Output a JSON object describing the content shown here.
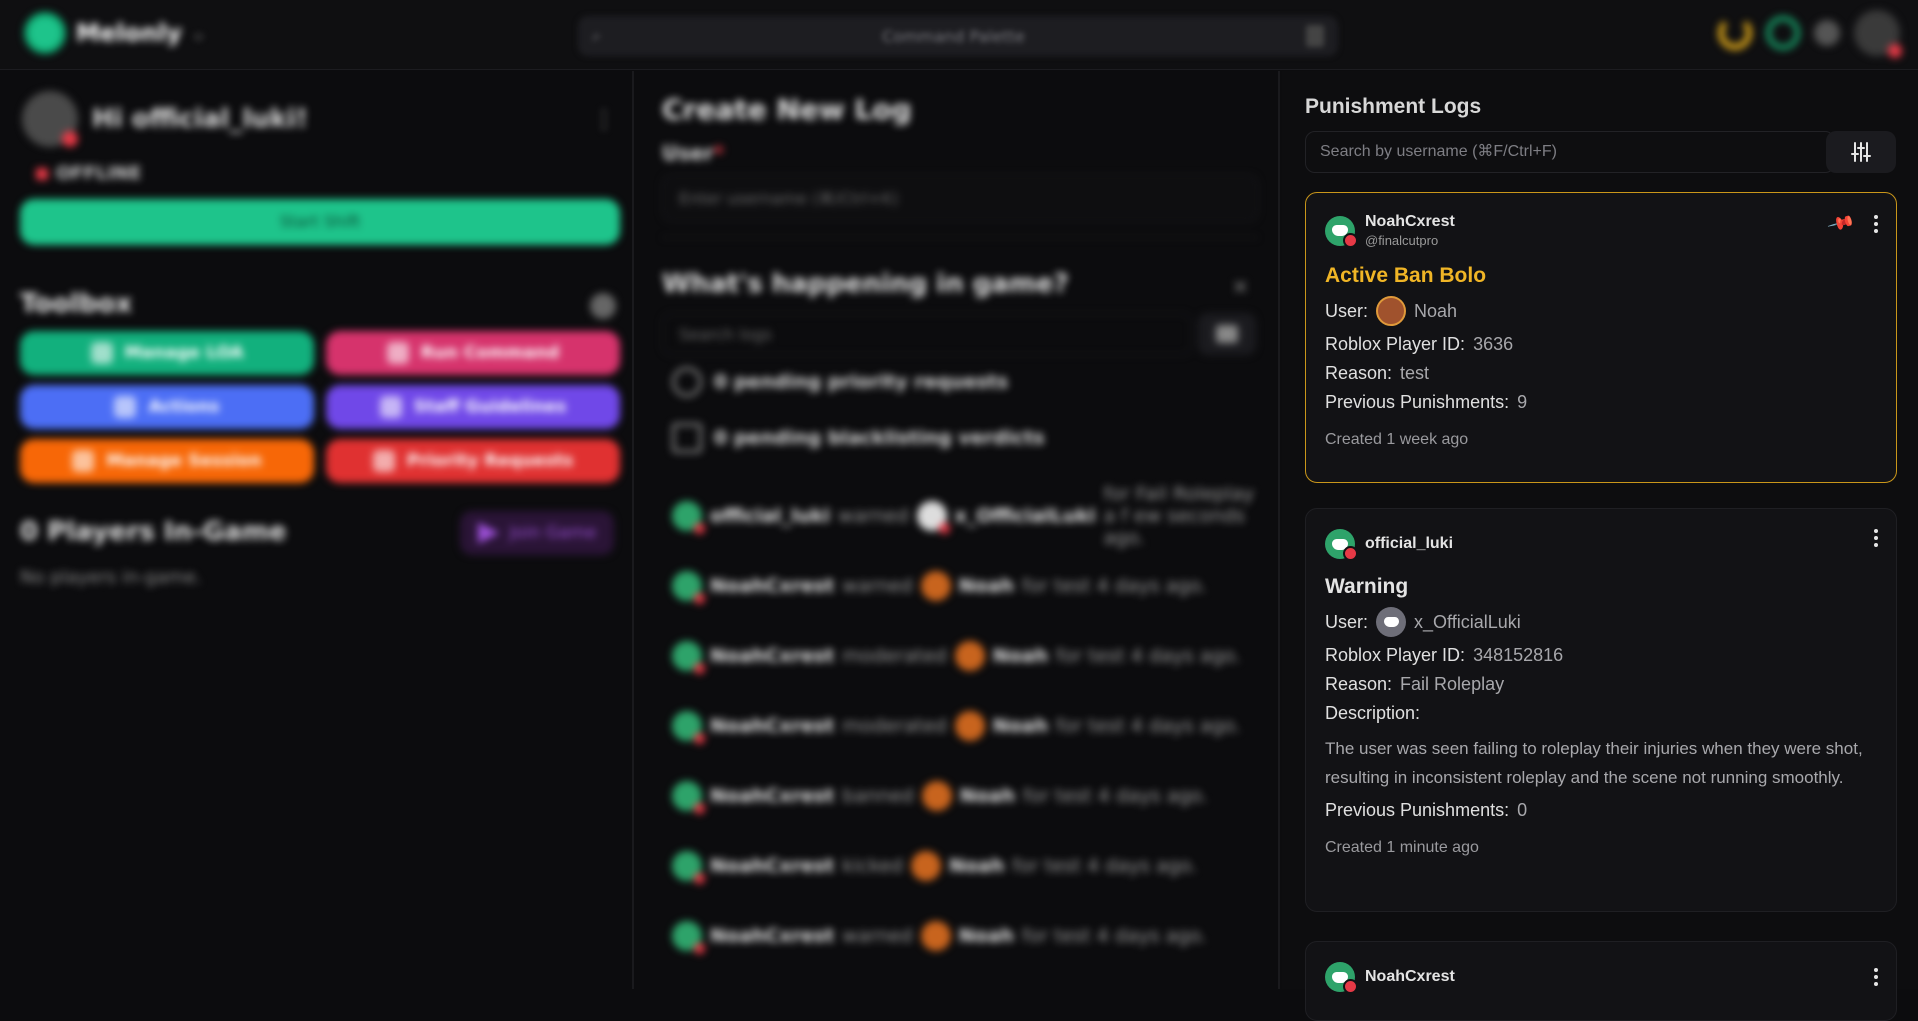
{
  "topbar": {
    "brand": "Melonly",
    "command_palette": "Command Palette"
  },
  "left": {
    "greeting": "Hi official_luki!",
    "status": "OFFLINE",
    "start_shift": "Start Shift",
    "toolbox_title": "Toolbox",
    "tools": [
      {
        "label": "Manage LOA",
        "color": "#12b07d"
      },
      {
        "label": "Run Command",
        "color": "#d6336c"
      },
      {
        "label": "Actions",
        "color": "#4c6ef5"
      },
      {
        "label": "Staff Guidelines",
        "color": "#7048e8"
      },
      {
        "label": "Manage Session",
        "color": "#f76707"
      },
      {
        "label": "Priority Requests",
        "color": "#e03131"
      }
    ],
    "players_title": "0 Players In-Game",
    "join_game": "Join Game",
    "no_players": "No players in-game."
  },
  "middle": {
    "title": "Create New Log",
    "user_label": "User",
    "user_placeholder": "Enter username (⌘/Ctrl+K)",
    "whats_happening": "What's happening in game?",
    "search_placeholder": "Search logs",
    "pending_priority": "0 pending priority requests",
    "pending_blacklist": "0 pending blacklisting verdicts",
    "feed": [
      {
        "actor": "official_luki",
        "action": "warned",
        "target": "x_OfficialLuki",
        "rest": "for Fail Roleplay a f ew seconds ago."
      },
      {
        "actor": "NoahCxrest",
        "action": "warned",
        "target": "Noah",
        "rest": "for test 4 days ago."
      },
      {
        "actor": "NoahCxrest",
        "action": "moderated",
        "target": "Noah",
        "rest": "for test 4 days ago."
      },
      {
        "actor": "NoahCxrest",
        "action": "moderated",
        "target": "Noah",
        "rest": "for test 4 days ago."
      },
      {
        "actor": "NoahCxrest",
        "action": "banned",
        "target": "Noah",
        "rest": "for test 4 days ago."
      },
      {
        "actor": "NoahCxrest",
        "action": "kicked",
        "target": "Noah",
        "rest": "for test 4 days ago."
      },
      {
        "actor": "NoahCxrest",
        "action": "warned",
        "target": "Noah",
        "rest": "for test 4 days ago."
      }
    ]
  },
  "right": {
    "title": "Punishment Logs",
    "search_placeholder": "Search by username (⌘F/Ctrl+F)",
    "cards": [
      {
        "username": "NoahCxrest",
        "handle": "@finalcutpro",
        "type": "Active Ban Bolo",
        "user_label": "User:",
        "user_value": "Noah",
        "player_id_label": "Roblox Player ID:",
        "player_id": "3636",
        "reason_label": "Reason:",
        "reason": "test",
        "prev_label": "Previous Punishments:",
        "prev": "9",
        "created": "Created 1 week ago"
      },
      {
        "username": "official_luki",
        "type": "Warning",
        "user_label": "User:",
        "user_value": "x_OfficialLuki",
        "player_id_label": "Roblox Player ID:",
        "player_id": "348152816",
        "reason_label": "Reason:",
        "reason": "Fail Roleplay",
        "description_label": "Description:",
        "description": "The user was seen failing to roleplay their injuries when they were shot, resulting in inconsistent roleplay and the scene not running smoothly.",
        "prev_label": "Previous Punishments:",
        "prev": "0",
        "created": "Created 1 minute ago"
      },
      {
        "username": "NoahCxrest"
      }
    ]
  }
}
